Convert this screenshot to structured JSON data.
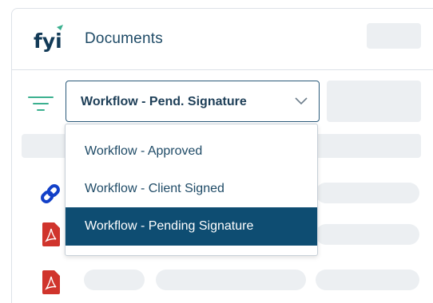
{
  "header": {
    "logo_text": "fyi",
    "title": "Documents"
  },
  "filter": {
    "selected_value": "Workflow - Pend. Signature",
    "options": [
      {
        "label": "Workflow - Approved",
        "selected": false
      },
      {
        "label": "Workflow - Client Signed",
        "selected": false
      },
      {
        "label": "Workflow - Pending Signature",
        "selected": true
      }
    ]
  },
  "rows": [
    {
      "icon": "link-icon"
    },
    {
      "icon": "pdf-icon"
    },
    {
      "icon": "pdf-icon"
    }
  ],
  "colors": {
    "accent": "#0e4d72",
    "title_text": "#1e4a66",
    "filter_green": "#3bb08f",
    "pdf_red": "#d0342c",
    "link_blue": "#1240c8",
    "placeholder": "#eceff2"
  }
}
